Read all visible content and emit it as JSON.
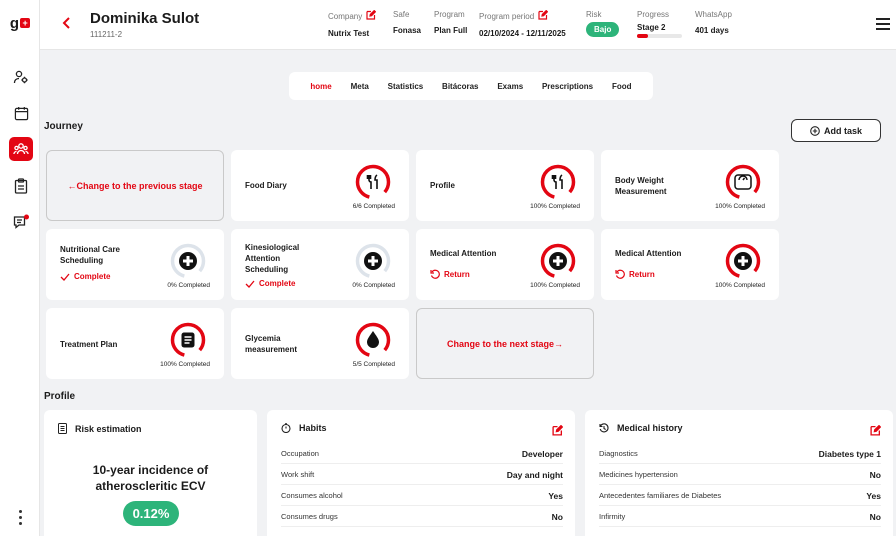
{
  "brand": {
    "letter": "g",
    "accent": "#e30613",
    "success": "#2db47a"
  },
  "header": {
    "patient_name": "Dominika Sulot",
    "patient_id": "111211-2",
    "company": {
      "label": "Company",
      "value": "Nutrix Test"
    },
    "safe": {
      "label": "Safe",
      "value": "Fonasa"
    },
    "program": {
      "label": "Program",
      "value": "Plan Full"
    },
    "program_period": {
      "label": "Program period",
      "value": "02/10/2024 - 12/11/2025"
    },
    "risk": {
      "label": "Risk",
      "value": "Bajo"
    },
    "progress": {
      "label": "Progress",
      "value": "Stage 2",
      "fraction": 0.25
    },
    "whatsapp": {
      "label": "WhatsApp",
      "value": "401 days"
    }
  },
  "tabs": [
    {
      "label": "home",
      "active": true
    },
    {
      "label": "Meta"
    },
    {
      "label": "Statistics"
    },
    {
      "label": "Bitácoras"
    },
    {
      "label": "Exams"
    },
    {
      "label": "Prescriptions"
    },
    {
      "label": "Food"
    }
  ],
  "journey": {
    "title": "Journey",
    "add_task": "Add task",
    "prev_stage": "←Change to the previous stage",
    "next_stage": "Change to the next stage→",
    "cards": [
      {
        "title": "Food Diary",
        "status": "6/6 Completed",
        "icon": "fork-knife-icon",
        "progress": 1
      },
      {
        "title": "Profile",
        "status": "100% Completed",
        "icon": "fork-knife-icon",
        "progress": 1
      },
      {
        "title": "Body Weight Measurement",
        "status": "100% Completed",
        "icon": "scale-icon",
        "progress": 1
      },
      {
        "title": "Nutritional Care Scheduling",
        "status": "0% Completed",
        "icon": "medical-cross-icon",
        "progress": 0,
        "action": "Complete"
      },
      {
        "title": "Kinesiological Attention Scheduling",
        "status": "0% Completed",
        "icon": "medical-cross-icon",
        "progress": 0,
        "action": "Complete"
      },
      {
        "title": "Medical Attention",
        "status": "100% Completed",
        "icon": "medical-cross-icon",
        "progress": 1,
        "action": "Return"
      },
      {
        "title": "Medical Attention",
        "status": "100% Completed",
        "icon": "medical-cross-icon",
        "progress": 1,
        "action": "Return"
      },
      {
        "title": "Treatment Plan",
        "status": "100% Completed",
        "icon": "clipboard-icon",
        "progress": 1
      },
      {
        "title": "Glycemia measurement",
        "status": "5/5 Completed",
        "icon": "drop-icon",
        "progress": 1
      }
    ]
  },
  "profile": {
    "title": "Profile",
    "risk": {
      "title": "Risk estimation",
      "heading": "10-year incidence of atheroscleritic ECV",
      "value": "0.12%"
    },
    "habits": {
      "title": "Habits",
      "rows": [
        {
          "k": "Occupation",
          "v": "Developer"
        },
        {
          "k": "Work shift",
          "v": "Day and night"
        },
        {
          "k": "Consumes alcohol",
          "v": "Yes"
        },
        {
          "k": "Consumes drugs",
          "v": "No"
        }
      ]
    },
    "history": {
      "title": "Medical history",
      "rows": [
        {
          "k": "Diagnostics",
          "v": "Diabetes type 1"
        },
        {
          "k": "Medicines hypertension",
          "v": "No"
        },
        {
          "k": "Antecedentes familiares de Diabetes",
          "v": "Yes"
        },
        {
          "k": "Infirmity",
          "v": "No"
        }
      ]
    }
  }
}
